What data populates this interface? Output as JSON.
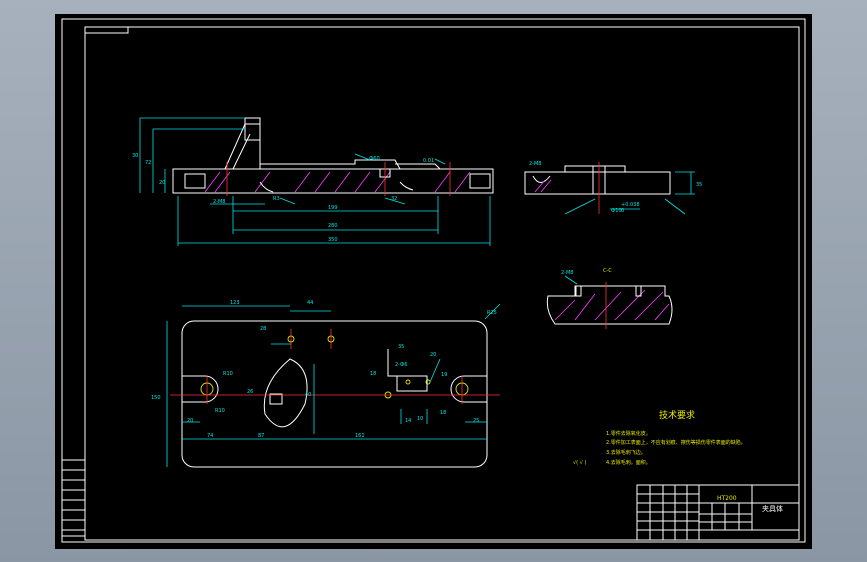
{
  "drawing": {
    "title_block": {
      "material": "HT200",
      "part_name": "夹具体",
      "left_column": [
        "",
        "",
        "",
        "",
        "",
        "",
        ""
      ],
      "footer_cells": [
        "",
        "",
        "",
        "",
        "",
        ""
      ]
    },
    "tech_requirements": {
      "heading": "技术要求",
      "items": [
        "1.零件去除氧化皮。",
        "2.零件加工表面上，不应有划痕、擦伤等损伤零件表面的缺陷。",
        "3.去除毛刺飞边。",
        "4.去除毛刺。面积。"
      ],
      "roughness_note": "√( √ )"
    },
    "dims_front": {
      "d30": "30",
      "d72": "72",
      "d20": "20",
      "d199": "199",
      "d280": "280",
      "d350": "350",
      "d2m8": "2-M8",
      "d10": "R3",
      "d60": "Ф60",
      "dphi10": "Ф10",
      "d160": "160",
      "d101": "101",
      "d32": "32",
      "d00": "0.01"
    },
    "dims_side": {
      "d2m6": "2-M8",
      "d35": "35",
      "tol": "+0.038",
      "d60": "Ф10",
      "d0": "0"
    },
    "section_label": "C-C",
    "section_note": "2-M8",
    "dims_top": {
      "d123": "123",
      "d44": "44",
      "d28": "28",
      "d150": "150",
      "d2m6": "2-Ф6",
      "d35": "35",
      "d18": "18",
      "r10": "R10",
      "r10b": "R10",
      "d19": "19",
      "d18b": "18",
      "d74": "74",
      "d87": "87",
      "d161": "161",
      "d20": "20",
      "d14": "14",
      "d25": "25",
      "d26": "26",
      "d40": "40",
      "r25": "R25",
      "d10": "10",
      "d20b": "20"
    }
  }
}
